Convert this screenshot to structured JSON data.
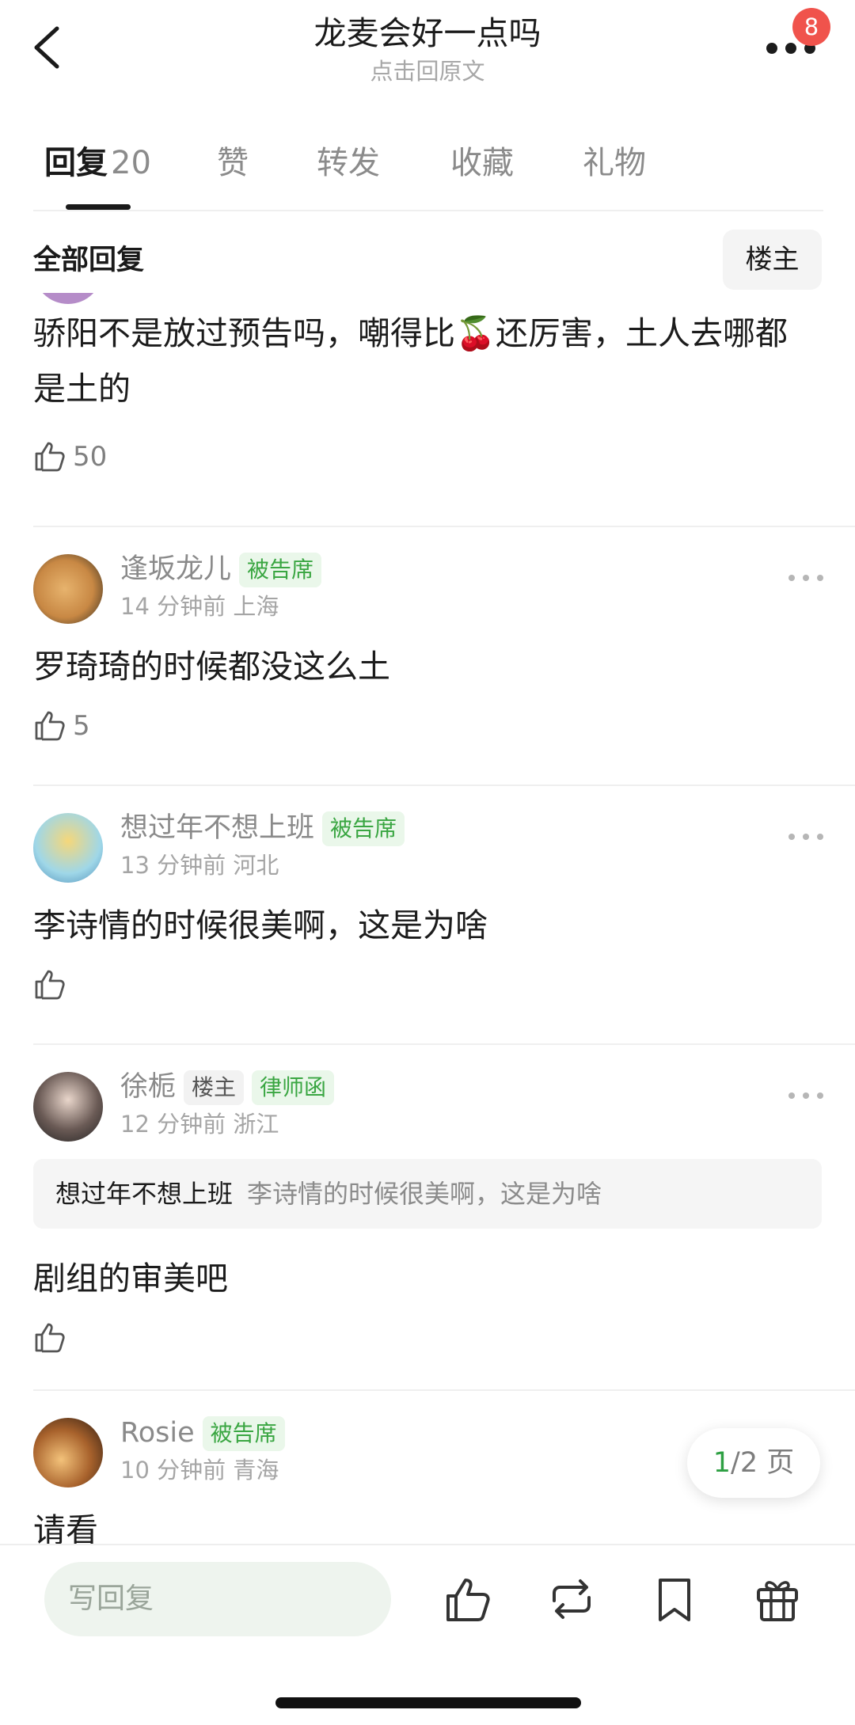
{
  "header": {
    "title": "龙麦会好一点吗",
    "subtitle": "点击回原文",
    "badge_count": "8"
  },
  "tabs": [
    {
      "label": "回复",
      "count": "20",
      "active": true
    },
    {
      "label": "赞"
    },
    {
      "label": "转发"
    },
    {
      "label": "收藏"
    },
    {
      "label": "礼物"
    }
  ],
  "filter": {
    "label": "全部回复",
    "op_button": "楼主"
  },
  "comments": [
    {
      "text": "骄阳不是放过预告吗，嘲得比🍒还厉害，土人去哪都是土的",
      "likes": "50"
    },
    {
      "username": "逢坂龙儿",
      "tags": [
        "被告席"
      ],
      "time": "14 分钟前",
      "location": "上海",
      "text": "罗琦琦的时候都没这么土",
      "likes": "5"
    },
    {
      "username": "想过年不想上班",
      "tags": [
        "被告席"
      ],
      "time": "13 分钟前",
      "location": "河北",
      "text": "李诗情的时候很美啊，这是为啥",
      "likes": ""
    },
    {
      "username": "徐栀",
      "tags": [
        "楼主",
        "律师函"
      ],
      "time": "12 分钟前",
      "location": "浙江",
      "quote_user": "想过年不想上班",
      "quote_text": "李诗情的时候很美啊，这是为啥",
      "text": "剧组的审美吧",
      "likes": ""
    },
    {
      "username": "Rosie",
      "tags": [
        "被告席"
      ],
      "time": "10 分钟前",
      "location": "青海",
      "text": "请看"
    }
  ],
  "pager": {
    "current": "1",
    "total_text": "/2 页"
  },
  "bottom_bar": {
    "reply_placeholder": "写回复",
    "icons": [
      "thumbs-up-icon",
      "repost-icon",
      "bookmark-icon",
      "gift-icon"
    ]
  },
  "colors": {
    "accent_green": "#3aa642",
    "badge_red": "#f0534c"
  }
}
